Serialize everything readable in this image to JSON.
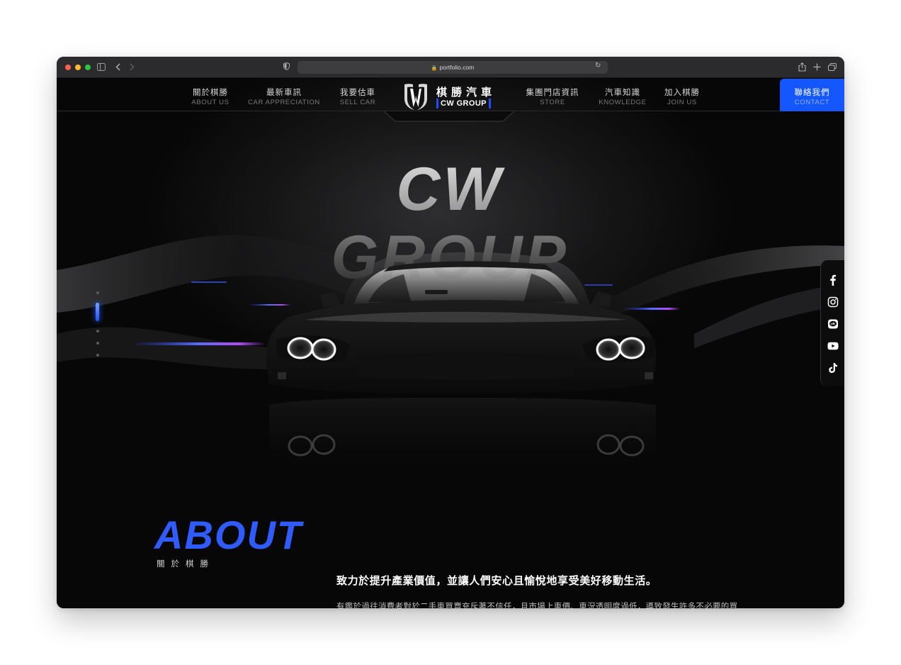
{
  "browser": {
    "url": "portfolio.com",
    "traffic_lights": [
      "#ff5f57",
      "#febc2e",
      "#28c840"
    ]
  },
  "nav": {
    "left": [
      {
        "zh": "關於棋勝",
        "en": "ABOUT US"
      },
      {
        "zh": "最新車訊",
        "en": "CAR APPRECIATION"
      },
      {
        "zh": "我要估車",
        "en": "SELL CAR"
      }
    ],
    "right": [
      {
        "zh": "集團門店資訊",
        "en": "STORE"
      },
      {
        "zh": "汽車知識",
        "en": "KNOWLEDGE"
      },
      {
        "zh": "加入棋勝",
        "en": "JOIN US"
      }
    ],
    "logo": {
      "zh": "棋勝汽車",
      "en": "CW GROUP"
    },
    "contact": {
      "zh": "聯絡我們",
      "en": "CONTACT"
    }
  },
  "hero": {
    "title": "CW GROUP",
    "slide_count": 5,
    "active_slide": 1
  },
  "social": [
    "facebook-icon",
    "instagram-icon",
    "line-icon",
    "youtube-icon",
    "tiktok-icon"
  ],
  "about": {
    "title": "ABOUT",
    "subtitle": "關於棋勝",
    "headline": "致力於提升產業價值，並讓人們安心且愉悅地享受美好移動生活。",
    "body": "有鑑於過往消費者對於二手車買賣充斥著不信任，且市場上車價、車況透明度過低，導致發生許多不必要的買賣糾紛，種種原因，我們秉持打造出一個舒適、透明且真實的購車體驗環境，「以顧客為中心」是我們品牌核心，而 C.W GROUP 正是 Customer Wins 的簡稱，我們相信顧客贏；就能贏得顧客。"
  },
  "colors": {
    "accent": "#1457ff",
    "about_title": "#2f5bff",
    "background": "#050505"
  }
}
